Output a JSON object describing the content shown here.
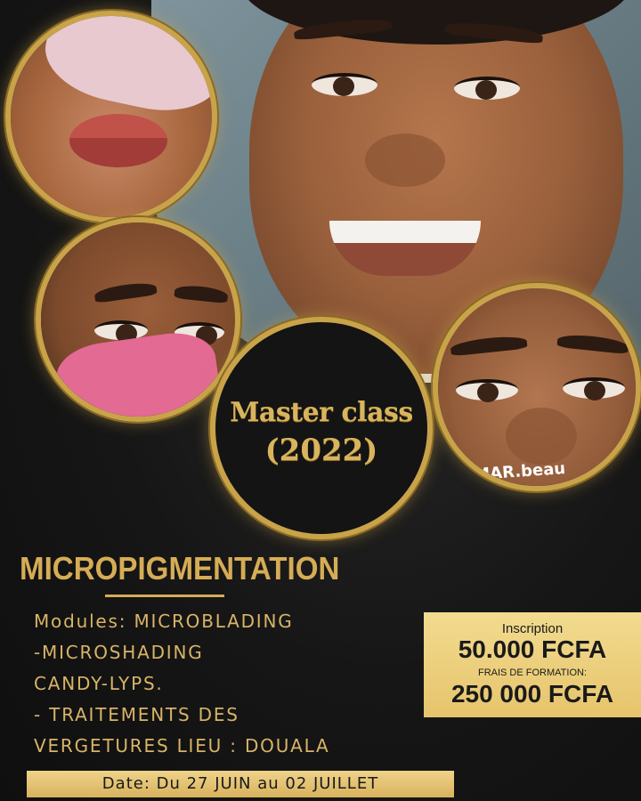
{
  "poster": {
    "title_line1": "Master class",
    "title_line2": "(2022)",
    "heading": "MICROPIGMENTATION",
    "modules": [
      "Modules: MICROBLADING",
      "-MICROSHADING",
      "CANDY-LYPS.",
      "- TRAITEMENTS DES",
      "VERGETURES LIEU : DOUALA"
    ],
    "price": {
      "inscription_label": "Inscription",
      "inscription_value": "50.000 FCFA",
      "formation_label": "FRAIS DE FORMATION:",
      "formation_value": "250 000 FCFA"
    },
    "date": "Date: Du 27 JUIN au 02 JUILLET",
    "watermark": "EMAR.beau"
  },
  "colors": {
    "background": "#141414",
    "gold": "#d6ac55",
    "price_box": "#efd488"
  },
  "images": {
    "hero": "portrait-photo",
    "circle1": "lips-photo",
    "circle2": "brows-mask-photo",
    "circle3": "eyes-close-up-photo"
  }
}
